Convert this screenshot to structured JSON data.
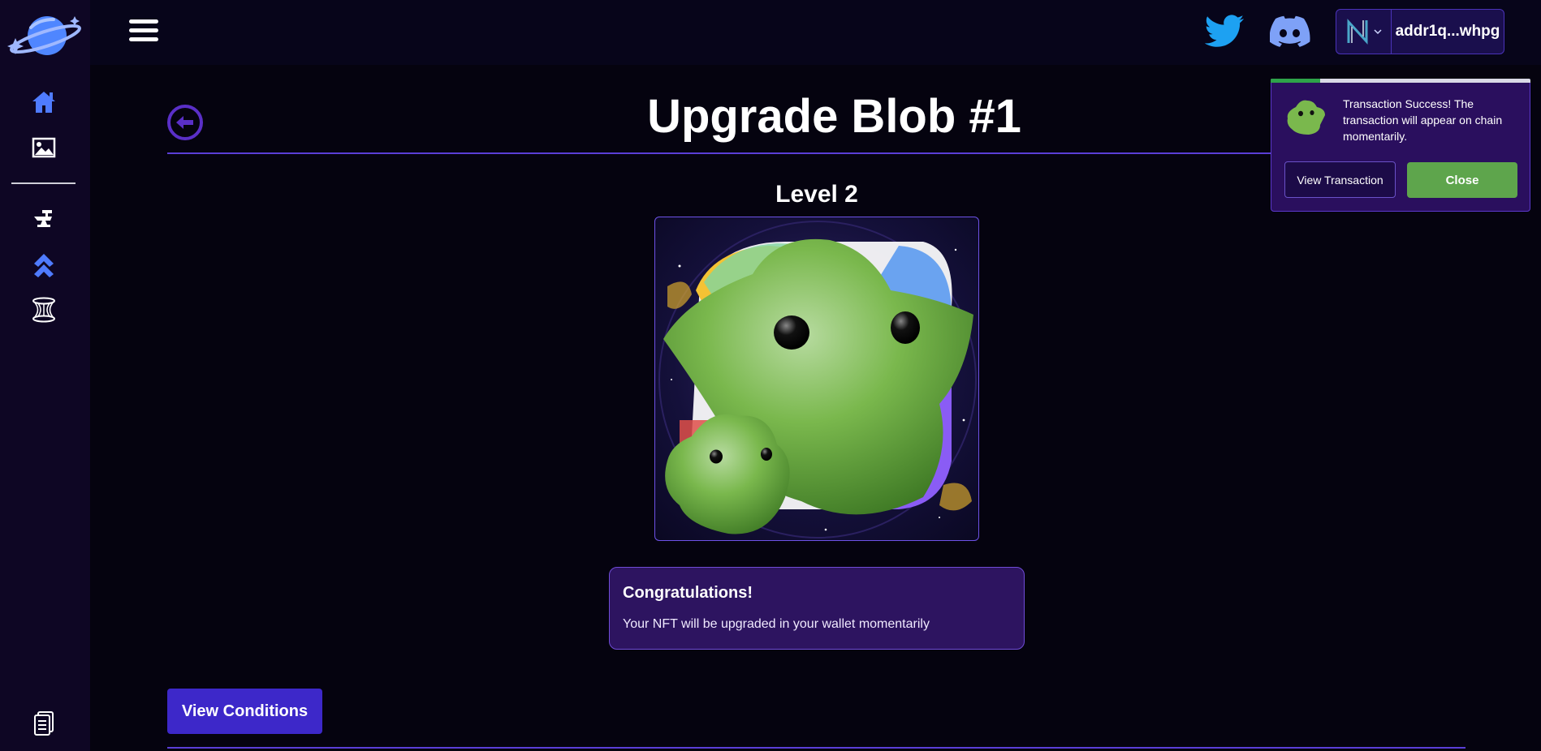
{
  "header": {
    "wallet_address": "addr1q...whpg"
  },
  "main": {
    "title": "Upgrade Blob #1",
    "level": "Level 2",
    "congrats_title": "Congratulations!",
    "congrats_text": "Your NFT will be upgraded in your wallet momentarily",
    "view_conditions_label": "View Conditions"
  },
  "toast": {
    "message": "Transaction Success! The transaction will appear on chain momentarily.",
    "view_label": "View Transaction",
    "close_label": "Close",
    "progress": 0.19
  },
  "sidebar": {
    "icons": [
      "home-icon",
      "gallery-icon",
      "forge-icon",
      "upgrade-icon",
      "portal-icon",
      "docs-icon"
    ]
  },
  "colors": {
    "accent": "#3d28c9",
    "sidebar_icon": "#4f7bff",
    "success": "#5ea54c",
    "twitter": "#1da1f2"
  }
}
